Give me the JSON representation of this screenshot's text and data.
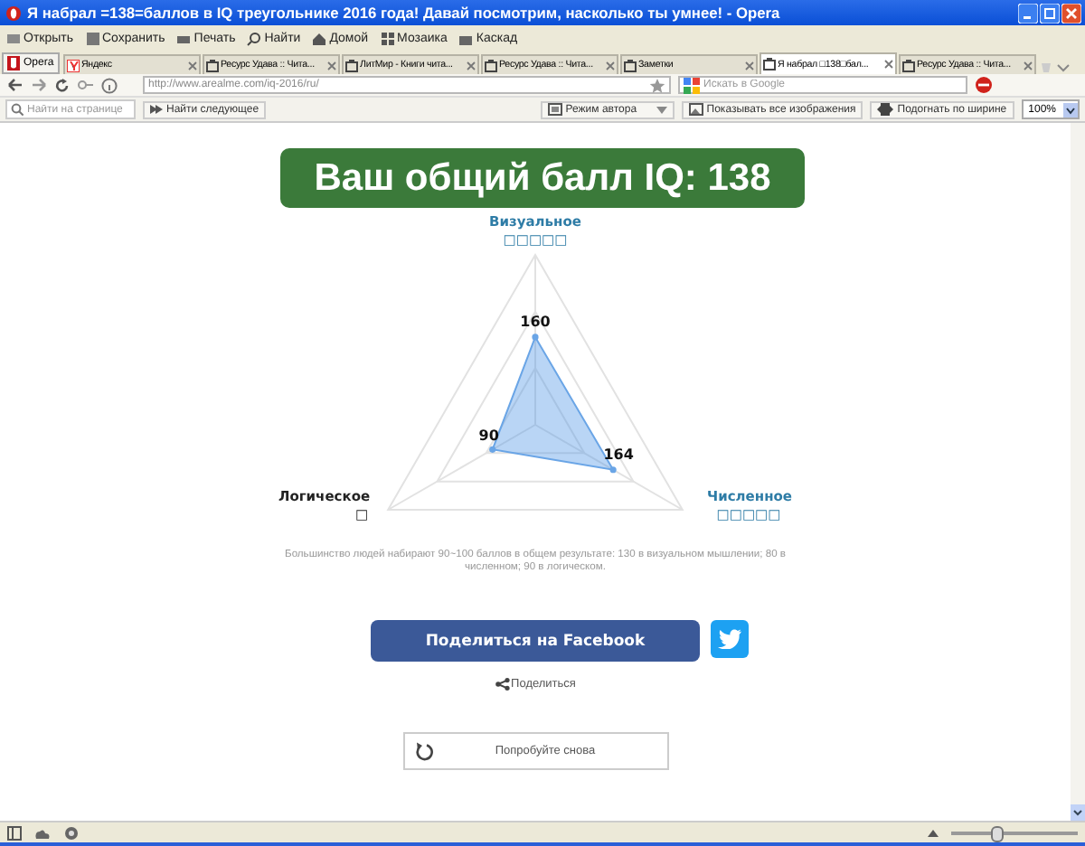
{
  "window": {
    "title": "Я набрал =138=баллов в IQ треугольнике 2016 года! Давай посмотрим, насколько ты умнее! - Opera"
  },
  "menu": [
    "Открыть",
    "Сохранить",
    "Печать",
    "Найти",
    "Домой",
    "Мозаика",
    "Каскад"
  ],
  "opera_button": "Opera",
  "tabs": [
    {
      "label": "Яндекс",
      "selected": false
    },
    {
      "label": "Ресурс Удава :: Чита...",
      "selected": false
    },
    {
      "label": "ЛитМир - Книги чита...",
      "selected": false
    },
    {
      "label": "Ресурс Удава :: Чита...",
      "selected": false
    },
    {
      "label": "Заметки",
      "selected": false
    },
    {
      "label": "Я набрал □138□бал...",
      "selected": true
    },
    {
      "label": "Ресурс Удава :: Чита...",
      "selected": false
    }
  ],
  "address": {
    "url": "http://www.arealme.com/iq-2016/ru/",
    "search_placeholder": "Искать в Google"
  },
  "find_bar": {
    "placeholder": "Найти на странице",
    "find_next": "Найти следующее",
    "author_mode": "Режим автора",
    "show_images": "Показывать все изображения",
    "fit_width": "Подогнать по ширине",
    "zoom": "100%"
  },
  "page": {
    "heading": "Ваш общий балл IQ: 138",
    "axes": [
      {
        "name": "Визуальное",
        "note": "□□□□□",
        "score": "160",
        "color": "#2e7ca6"
      },
      {
        "name": "Логическое",
        "note": "□",
        "score": "90",
        "color": "#222222"
      },
      {
        "name": "Численное",
        "note": "□□□□□",
        "score": "164",
        "color": "#2e7ca6"
      }
    ],
    "footnote": "Большинство людей набирают 90~100 баллов в общем результате: 130 в визуальном мышлении; 80 в численном; 90 в логическом.",
    "facebook_button": "Поделиться на Facebook",
    "share_link": "Поделиться",
    "retry_button": "Попробуйте снова"
  },
  "status_bar": {
    "zoom_slider": {
      "level": 0.35
    }
  }
}
